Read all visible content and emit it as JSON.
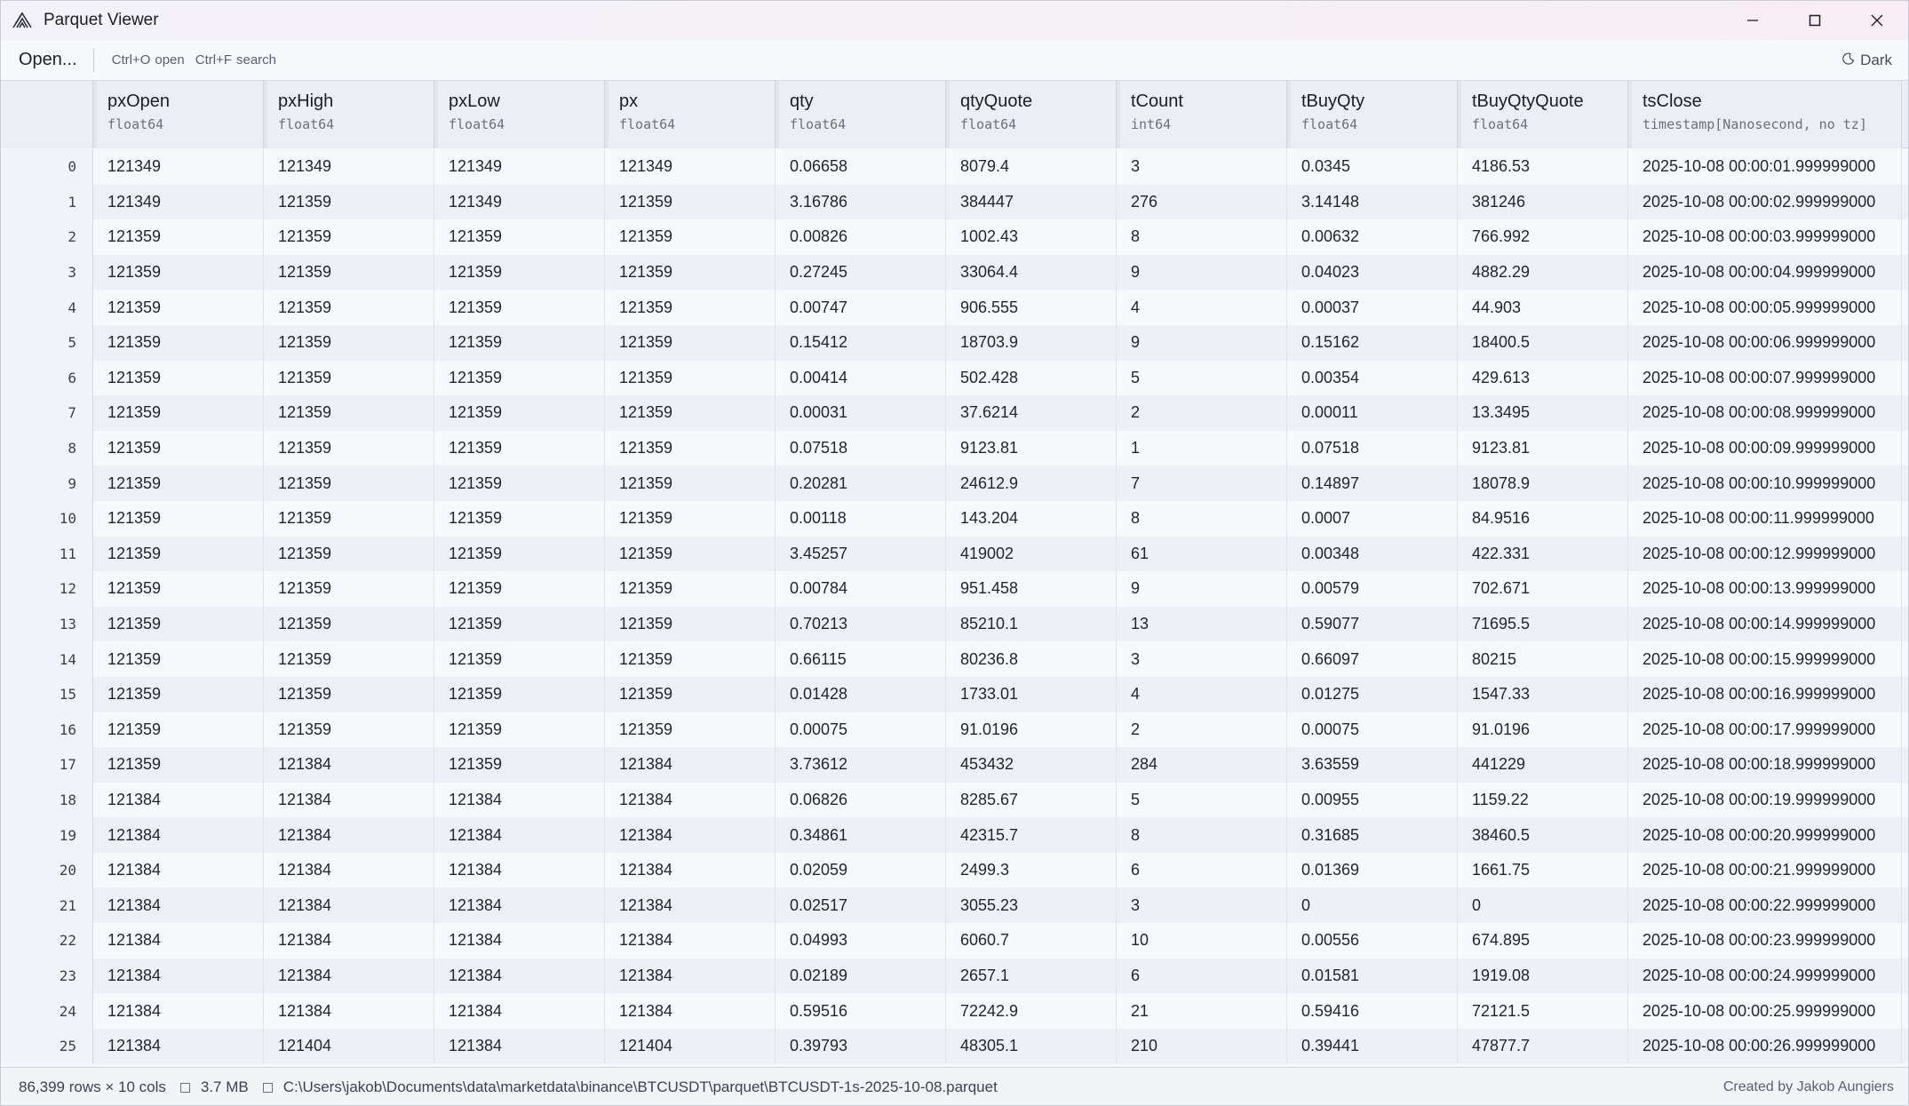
{
  "window": {
    "title": "Parquet Viewer",
    "controls": [
      "minimize-icon",
      "maximize-icon",
      "close-icon"
    ]
  },
  "toolbar": {
    "open_label": "Open...",
    "hint_open_key": "Ctrl+O",
    "hint_open_label": "open",
    "hint_search_key": "Ctrl+F",
    "hint_search_label": "search",
    "theme_label": "Dark",
    "theme_icon": "moon-icon"
  },
  "table": {
    "columns": [
      {
        "name": "pxOpen",
        "type": "float64"
      },
      {
        "name": "pxHigh",
        "type": "float64"
      },
      {
        "name": "pxLow",
        "type": "float64"
      },
      {
        "name": "px",
        "type": "float64"
      },
      {
        "name": "qty",
        "type": "float64"
      },
      {
        "name": "qtyQuote",
        "type": "float64"
      },
      {
        "name": "tCount",
        "type": "int64"
      },
      {
        "name": "tBuyQty",
        "type": "float64"
      },
      {
        "name": "tBuyQtyQuote",
        "type": "float64"
      },
      {
        "name": "tsClose",
        "type": "timestamp[Nanosecond, no tz]"
      }
    ],
    "rows": [
      {
        "idx": "0",
        "cells": [
          "121349",
          "121349",
          "121349",
          "121349",
          "0.06658",
          "8079.4",
          "3",
          "0.0345",
          "4186.53",
          "2025-10-08 00:00:01.999999000"
        ]
      },
      {
        "idx": "1",
        "cells": [
          "121349",
          "121359",
          "121349",
          "121359",
          "3.16786",
          "384447",
          "276",
          "3.14148",
          "381246",
          "2025-10-08 00:00:02.999999000"
        ]
      },
      {
        "idx": "2",
        "cells": [
          "121359",
          "121359",
          "121359",
          "121359",
          "0.00826",
          "1002.43",
          "8",
          "0.00632",
          "766.992",
          "2025-10-08 00:00:03.999999000"
        ]
      },
      {
        "idx": "3",
        "cells": [
          "121359",
          "121359",
          "121359",
          "121359",
          "0.27245",
          "33064.4",
          "9",
          "0.04023",
          "4882.29",
          "2025-10-08 00:00:04.999999000"
        ]
      },
      {
        "idx": "4",
        "cells": [
          "121359",
          "121359",
          "121359",
          "121359",
          "0.00747",
          "906.555",
          "4",
          "0.00037",
          "44.903",
          "2025-10-08 00:00:05.999999000"
        ]
      },
      {
        "idx": "5",
        "cells": [
          "121359",
          "121359",
          "121359",
          "121359",
          "0.15412",
          "18703.9",
          "9",
          "0.15162",
          "18400.5",
          "2025-10-08 00:00:06.999999000"
        ]
      },
      {
        "idx": "6",
        "cells": [
          "121359",
          "121359",
          "121359",
          "121359",
          "0.00414",
          "502.428",
          "5",
          "0.00354",
          "429.613",
          "2025-10-08 00:00:07.999999000"
        ]
      },
      {
        "idx": "7",
        "cells": [
          "121359",
          "121359",
          "121359",
          "121359",
          "0.00031",
          "37.6214",
          "2",
          "0.00011",
          "13.3495",
          "2025-10-08 00:00:08.999999000"
        ]
      },
      {
        "idx": "8",
        "cells": [
          "121359",
          "121359",
          "121359",
          "121359",
          "0.07518",
          "9123.81",
          "1",
          "0.07518",
          "9123.81",
          "2025-10-08 00:00:09.999999000"
        ]
      },
      {
        "idx": "9",
        "cells": [
          "121359",
          "121359",
          "121359",
          "121359",
          "0.20281",
          "24612.9",
          "7",
          "0.14897",
          "18078.9",
          "2025-10-08 00:00:10.999999000"
        ]
      },
      {
        "idx": "10",
        "cells": [
          "121359",
          "121359",
          "121359",
          "121359",
          "0.00118",
          "143.204",
          "8",
          "0.0007",
          "84.9516",
          "2025-10-08 00:00:11.999999000"
        ]
      },
      {
        "idx": "11",
        "cells": [
          "121359",
          "121359",
          "121359",
          "121359",
          "3.45257",
          "419002",
          "61",
          "0.00348",
          "422.331",
          "2025-10-08 00:00:12.999999000"
        ]
      },
      {
        "idx": "12",
        "cells": [
          "121359",
          "121359",
          "121359",
          "121359",
          "0.00784",
          "951.458",
          "9",
          "0.00579",
          "702.671",
          "2025-10-08 00:00:13.999999000"
        ]
      },
      {
        "idx": "13",
        "cells": [
          "121359",
          "121359",
          "121359",
          "121359",
          "0.70213",
          "85210.1",
          "13",
          "0.59077",
          "71695.5",
          "2025-10-08 00:00:14.999999000"
        ]
      },
      {
        "idx": "14",
        "cells": [
          "121359",
          "121359",
          "121359",
          "121359",
          "0.66115",
          "80236.8",
          "3",
          "0.66097",
          "80215",
          "2025-10-08 00:00:15.999999000"
        ]
      },
      {
        "idx": "15",
        "cells": [
          "121359",
          "121359",
          "121359",
          "121359",
          "0.01428",
          "1733.01",
          "4",
          "0.01275",
          "1547.33",
          "2025-10-08 00:00:16.999999000"
        ]
      },
      {
        "idx": "16",
        "cells": [
          "121359",
          "121359",
          "121359",
          "121359",
          "0.00075",
          "91.0196",
          "2",
          "0.00075",
          "91.0196",
          "2025-10-08 00:00:17.999999000"
        ]
      },
      {
        "idx": "17",
        "cells": [
          "121359",
          "121384",
          "121359",
          "121384",
          "3.73612",
          "453432",
          "284",
          "3.63559",
          "441229",
          "2025-10-08 00:00:18.999999000"
        ]
      },
      {
        "idx": "18",
        "cells": [
          "121384",
          "121384",
          "121384",
          "121384",
          "0.06826",
          "8285.67",
          "5",
          "0.00955",
          "1159.22",
          "2025-10-08 00:00:19.999999000"
        ]
      },
      {
        "idx": "19",
        "cells": [
          "121384",
          "121384",
          "121384",
          "121384",
          "0.34861",
          "42315.7",
          "8",
          "0.31685",
          "38460.5",
          "2025-10-08 00:00:20.999999000"
        ]
      },
      {
        "idx": "20",
        "cells": [
          "121384",
          "121384",
          "121384",
          "121384",
          "0.02059",
          "2499.3",
          "6",
          "0.01369",
          "1661.75",
          "2025-10-08 00:00:21.999999000"
        ]
      },
      {
        "idx": "21",
        "cells": [
          "121384",
          "121384",
          "121384",
          "121384",
          "0.02517",
          "3055.23",
          "3",
          "0",
          "0",
          "2025-10-08 00:00:22.999999000"
        ]
      },
      {
        "idx": "22",
        "cells": [
          "121384",
          "121384",
          "121384",
          "121384",
          "0.04993",
          "6060.7",
          "10",
          "0.00556",
          "674.895",
          "2025-10-08 00:00:23.999999000"
        ]
      },
      {
        "idx": "23",
        "cells": [
          "121384",
          "121384",
          "121384",
          "121384",
          "0.02189",
          "2657.1",
          "6",
          "0.01581",
          "1919.08",
          "2025-10-08 00:00:24.999999000"
        ]
      },
      {
        "idx": "24",
        "cells": [
          "121384",
          "121384",
          "121384",
          "121384",
          "0.59516",
          "72242.9",
          "21",
          "0.59416",
          "72121.5",
          "2025-10-08 00:00:25.999999000"
        ]
      },
      {
        "idx": "25",
        "cells": [
          "121384",
          "121404",
          "121384",
          "121404",
          "0.39793",
          "48305.1",
          "210",
          "0.39441",
          "47877.7",
          "2025-10-08 00:00:26.999999000"
        ]
      }
    ]
  },
  "statusbar": {
    "rows_cols": "86,399 rows  ×  10 cols",
    "size": "3.7 MB",
    "path": "C:\\Users\\jakob\\Documents\\data\\marketdata\\binance\\BTCUSDT\\parquet\\BTCUSDT-1s-2025-10-08.parquet",
    "credit": "Created by Jakob Aungiers"
  }
}
